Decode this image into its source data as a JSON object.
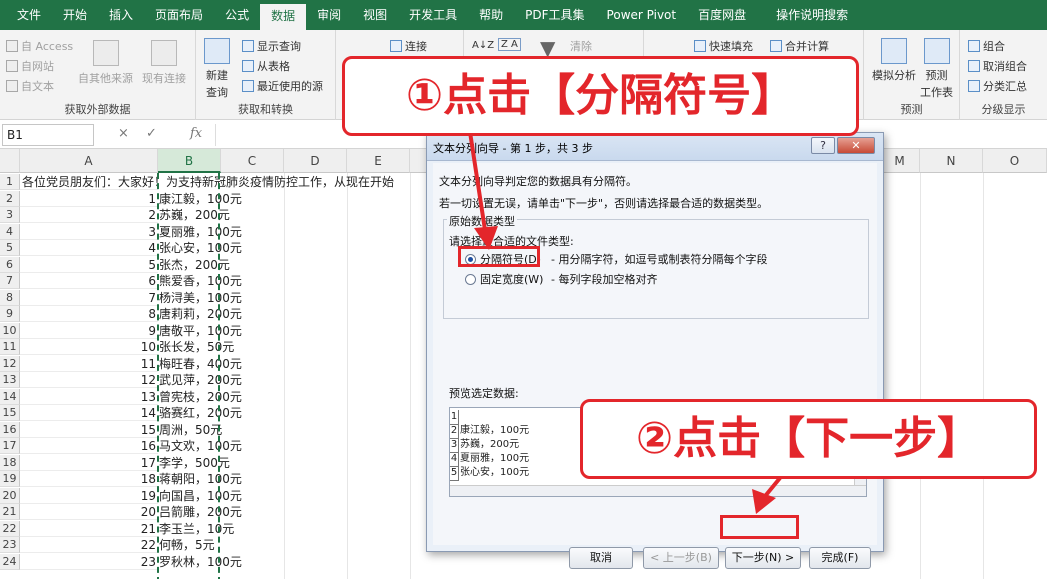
{
  "ribbon": {
    "tabs": [
      "文件",
      "开始",
      "插入",
      "页面布局",
      "公式",
      "数据",
      "审阅",
      "视图",
      "开发工具",
      "帮助",
      "PDF工具集",
      "Power Pivot",
      "百度网盘",
      "操作说明搜索"
    ],
    "active_tab": "数据",
    "get_external": {
      "access": "自 Access",
      "web": "自网站",
      "text": "自文本",
      "other": "自其他来源",
      "existing": "现有连接",
      "label": "获取外部数据"
    },
    "get_transform": {
      "new_query_1": "新建",
      "new_query_2": "查询",
      "show_query": "显示查询",
      "from_table": "从表格",
      "recent": "最近使用的源",
      "label": "获取和转换"
    },
    "connect": {
      "connections": "连接"
    },
    "sort": {
      "az": "A↓Z",
      "za": "Z A"
    },
    "filter": {
      "clear": "清除"
    },
    "tools": {
      "flash_fill": "快速填充",
      "consolidate": "合并计算"
    },
    "forecast": {
      "whatif": "模拟分析",
      "sheet_1": "预测",
      "sheet_2": "工作表",
      "label": "预测"
    },
    "outline": {
      "group": "组合",
      "ungroup": "取消组合",
      "subtotal": "分类汇总",
      "label": "分级显示"
    }
  },
  "formula_bar": {
    "name_box": "B1",
    "fx": "fx",
    "cancel": "×",
    "confirm": "✓"
  },
  "columns": [
    "A",
    "B",
    "C",
    "D",
    "E",
    "M",
    "N",
    "O"
  ],
  "row1_text": "各位党员朋友们：大家好！为支持新冠肺炎疫情防控工作，从现在开始",
  "rows": [
    {
      "n": "1",
      "a": "",
      "b": ""
    },
    {
      "n": "2",
      "a": "1",
      "b": "康江毅，100元"
    },
    {
      "n": "3",
      "a": "2",
      "b": "苏巍，200元"
    },
    {
      "n": "4",
      "a": "3",
      "b": "夏丽雅，100元"
    },
    {
      "n": "5",
      "a": "4",
      "b": "张心安，100元"
    },
    {
      "n": "6",
      "a": "5",
      "b": "张杰，200元"
    },
    {
      "n": "7",
      "a": "6",
      "b": "熊爱香，100元"
    },
    {
      "n": "8",
      "a": "7",
      "b": "杨浔美，100元"
    },
    {
      "n": "9",
      "a": "8",
      "b": "唐莉莉，200元"
    },
    {
      "n": "10",
      "a": "9",
      "b": "唐敬平，100元"
    },
    {
      "n": "11",
      "a": "10",
      "b": "张长发，50元"
    },
    {
      "n": "12",
      "a": "11",
      "b": "梅旺春，400元"
    },
    {
      "n": "13",
      "a": "12",
      "b": "武见萍，200元"
    },
    {
      "n": "14",
      "a": "13",
      "b": "曾宪枝，200元"
    },
    {
      "n": "15",
      "a": "14",
      "b": "骆赛红，200元"
    },
    {
      "n": "16",
      "a": "15",
      "b": "周洲，50元"
    },
    {
      "n": "17",
      "a": "16",
      "b": "马文欢，100元"
    },
    {
      "n": "18",
      "a": "17",
      "b": "李学，500元"
    },
    {
      "n": "19",
      "a": "18",
      "b": "蒋朝阳，100元"
    },
    {
      "n": "20",
      "a": "19",
      "b": "向国昌，100元"
    },
    {
      "n": "21",
      "a": "20",
      "b": "吕箭雕，200元"
    },
    {
      "n": "22",
      "a": "21",
      "b": "李玉兰，10元"
    },
    {
      "n": "23",
      "a": "22",
      "b": "何畅，5元"
    },
    {
      "n": "24",
      "a": "23",
      "b": "罗秋林，100元"
    }
  ],
  "dialog": {
    "title": "文本分列向导 - 第 1 步，共 3 步",
    "help": "?",
    "close": "✕",
    "line1": "文本分列向导判定您的数据具有分隔符。",
    "line2": "若一切设置无误，请单击\"下一步\"，否则请选择最合适的数据类型。",
    "original_type": "原始数据类型",
    "choose": "请选择最合适的文件类型:",
    "opt1": "分隔符号(D)",
    "opt1_desc": "- 用分隔字符，如逗号或制表符分隔每个字段",
    "opt2": "固定宽度(W)",
    "opt2_desc": "- 每列字段加空格对齐",
    "preview_label": "预览选定数据:",
    "preview": [
      {
        "n": "1",
        "t": ""
      },
      {
        "n": "2",
        "t": "康江毅，100元"
      },
      {
        "n": "3",
        "t": "苏巍，200元"
      },
      {
        "n": "4",
        "t": "夏丽雅，100元"
      },
      {
        "n": "5",
        "t": "张心安，100元"
      }
    ],
    "btn_cancel": "取消",
    "btn_back": "< 上一步(B)",
    "btn_next": "下一步(N) >",
    "btn_finish": "完成(F)"
  },
  "annotations": {
    "step1": "①点击【分隔符号】",
    "step2": "②点击【下一步】",
    "color": "#e3262b"
  }
}
